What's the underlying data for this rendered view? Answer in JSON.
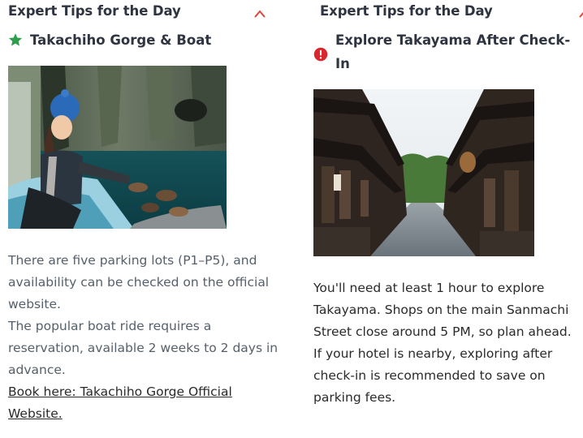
{
  "left_card": {
    "section_title": "Expert Tips for the Day",
    "tip_title": "Takachiho Gorge & Boat",
    "tip_icon": "star-icon",
    "tip_icon_color": "#2e9e4a",
    "paragraph_1": "There are five parking lots (P1–P5), and availability can be checked on the official website.",
    "paragraph_2": "The popular boat ride requires a reservation, available 2 weeks to 2 days in advance.",
    "link_text": "Book here: Takachiho Gorge Official Website."
  },
  "right_card": {
    "section_title": "Expert Tips for the Day",
    "tip_title": "Explore Takayama After Check-In",
    "tip_icon": "alert-icon",
    "tip_icon_color": "#d9252b",
    "paragraph_1": "You'll need at least 1 hour to explore Takayama. Shops on the main Sanmachi Street close around 5 PM, so plan ahead.",
    "paragraph_2": "If your hotel is nearby, exploring after check-in is recommended to save on parking fees."
  },
  "colors": {
    "accent": "#e0453a",
    "heading": "#2e3440",
    "left_body": "#56606b",
    "right_body": "#2a2a2a"
  }
}
